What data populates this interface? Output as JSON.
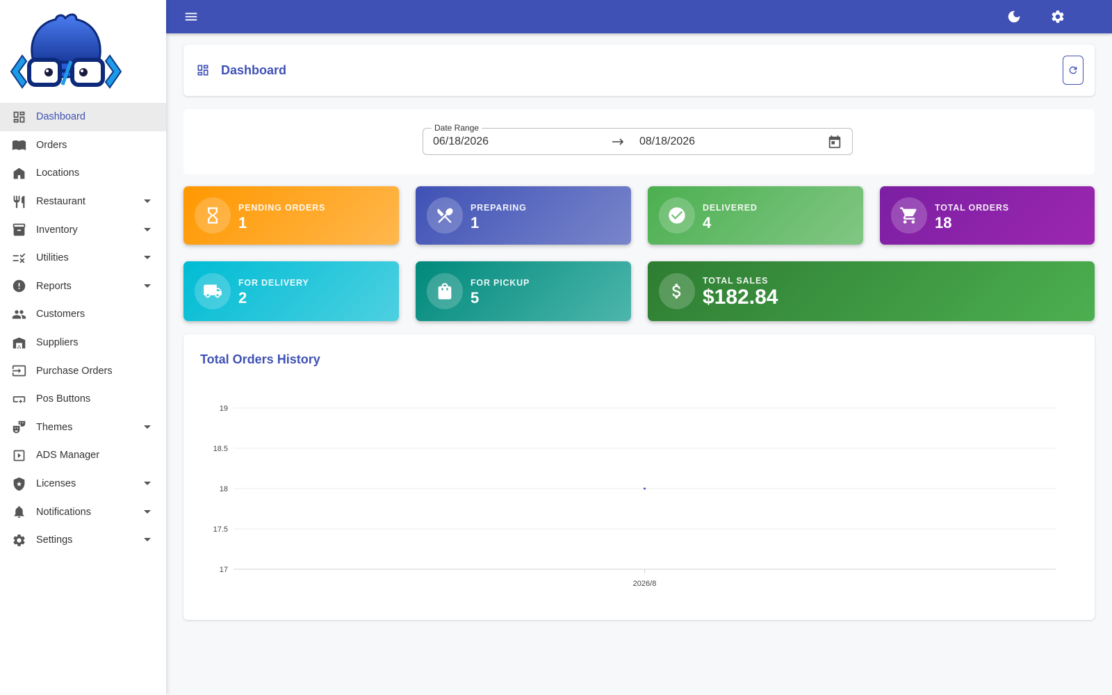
{
  "colors": {
    "primary": "#3f51b5",
    "sidebar_bg": "#ffffff",
    "page_bg": "#f7f8fa"
  },
  "sidebar": {
    "items": [
      {
        "label": "Dashboard",
        "icon": "dashboard-icon",
        "active": true,
        "expandable": false
      },
      {
        "label": "Orders",
        "icon": "menu-book-icon",
        "active": false,
        "expandable": false
      },
      {
        "label": "Locations",
        "icon": "store-icon",
        "active": false,
        "expandable": false
      },
      {
        "label": "Restaurant",
        "icon": "restaurant-icon",
        "active": false,
        "expandable": true
      },
      {
        "label": "Inventory",
        "icon": "inventory-icon",
        "active": false,
        "expandable": true
      },
      {
        "label": "Utilities",
        "icon": "rule-icon",
        "active": false,
        "expandable": true
      },
      {
        "label": "Reports",
        "icon": "report-icon",
        "active": false,
        "expandable": true
      },
      {
        "label": "Customers",
        "icon": "people-icon",
        "active": false,
        "expandable": false
      },
      {
        "label": "Suppliers",
        "icon": "warehouse-icon",
        "active": false,
        "expandable": false
      },
      {
        "label": "Purchase Orders",
        "icon": "input-icon",
        "active": false,
        "expandable": false
      },
      {
        "label": "Pos Buttons",
        "icon": "smart-button-icon",
        "active": false,
        "expandable": false
      },
      {
        "label": "Themes",
        "icon": "theater-masks-icon",
        "active": false,
        "expandable": true
      },
      {
        "label": "ADS Manager",
        "icon": "slideshow-icon",
        "active": false,
        "expandable": false
      },
      {
        "label": "Licenses",
        "icon": "shield-star-icon",
        "active": false,
        "expandable": true
      },
      {
        "label": "Notifications",
        "icon": "bell-icon",
        "active": false,
        "expandable": true
      },
      {
        "label": "Settings",
        "icon": "gear-icon",
        "active": false,
        "expandable": true
      }
    ]
  },
  "topbar": {
    "menu_icon": "hamburger-menu-icon",
    "theme_icon": "moon-icon",
    "settings_icon": "gear-icon"
  },
  "header": {
    "title": "Dashboard",
    "icon": "dashboard-icon",
    "refresh_icon": "refresh-icon"
  },
  "date_range": {
    "label": "Date Range",
    "start": "06/18/2026",
    "end": "08/18/2026",
    "calendar_icon": "calendar-icon"
  },
  "stats": {
    "pending": {
      "label": "Pending Orders",
      "value": "1",
      "icon": "hourglass-icon",
      "color": "#ff9800"
    },
    "preparing": {
      "label": "Preparing",
      "value": "1",
      "icon": "utensils-crossed-icon",
      "color": "#3f51b5"
    },
    "delivered": {
      "label": "Delivered",
      "value": "4",
      "icon": "check-circle-icon",
      "color": "#4caf50"
    },
    "total_orders": {
      "label": "Total Orders",
      "value": "18",
      "icon": "cart-icon",
      "color": "#9c27b0"
    },
    "for_delivery": {
      "label": "For Delivery",
      "value": "2",
      "icon": "truck-icon",
      "color": "#00bcd4"
    },
    "for_pickup": {
      "label": "For Pickup",
      "value": "5",
      "icon": "shopping-bag-icon",
      "color": "#009688"
    },
    "total_sales": {
      "label": "Total Sales",
      "value": "$182.84",
      "icon": "dollar-icon",
      "color": "#2e7d32"
    }
  },
  "chart": {
    "title": "Total Orders History"
  },
  "chart_data": {
    "type": "line",
    "title": "Total Orders History",
    "categories": [
      "2026/8"
    ],
    "series": [
      {
        "values": [
          18
        ]
      }
    ],
    "yticks": [
      "19",
      "18.5",
      "18",
      "17.5",
      "17"
    ],
    "ylim": [
      17,
      19
    ],
    "grid": true
  }
}
